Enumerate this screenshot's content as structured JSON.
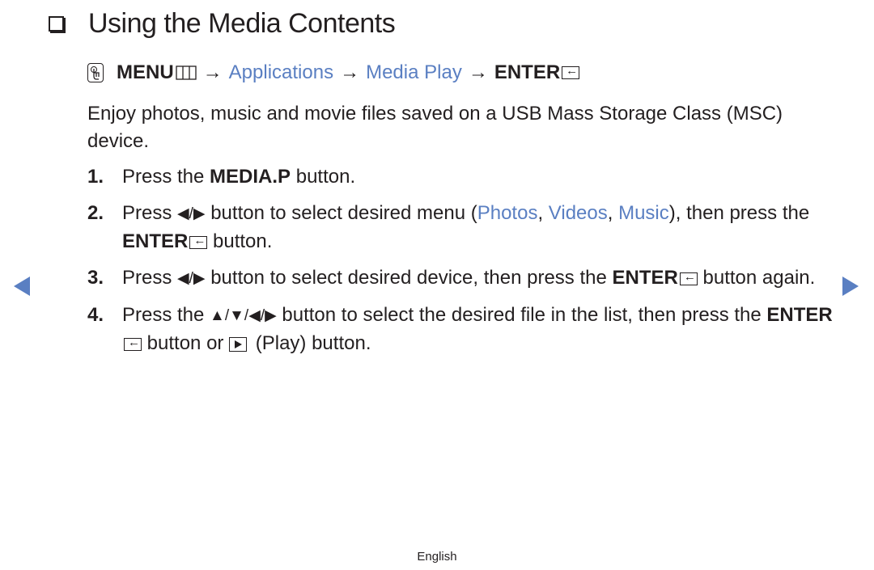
{
  "title": "Using the Media Contents",
  "menu_path": {
    "menu": "MENU",
    "menu_icon": "menu-grid-icon",
    "arrow": "→",
    "applications": "Applications",
    "media_play": "Media Play",
    "enter": "ENTER",
    "ok_icon": "ok-hand-icon"
  },
  "intro": "Enjoy photos, music and movie files saved on a USB Mass Storage Class (MSC) device.",
  "steps": [
    {
      "num": "1.",
      "a": "Press the ",
      "b": "MEDIA.P",
      "c": " button."
    },
    {
      "num": "2.",
      "a": "Press ",
      "lr": "◀/▶",
      "b": " button to select desired menu (",
      "photos": "Photos",
      "comma1": ", ",
      "videos": "Videos",
      "comma2": ", ",
      "music": "Music",
      "c": "), then press the ",
      "enter": "ENTER",
      "d": " button."
    },
    {
      "num": "3.",
      "a": "Press ",
      "lr": "◀/▶",
      "b": " button to select desired device, then press the ",
      "enter": "ENTER",
      "c": " button again."
    },
    {
      "num": "4.",
      "a": "Press the ",
      "dirs": "▲/▼/◀/▶",
      "b": " button to select the desired file in the list, then press the ",
      "enter": "ENTER",
      "c": " button or ",
      "d": " (Play) button."
    }
  ],
  "nav": {
    "prev": "previous-page",
    "next": "next-page"
  },
  "footer": "English",
  "colors": {
    "accent": "#5a7fc2",
    "text": "#231f20"
  }
}
